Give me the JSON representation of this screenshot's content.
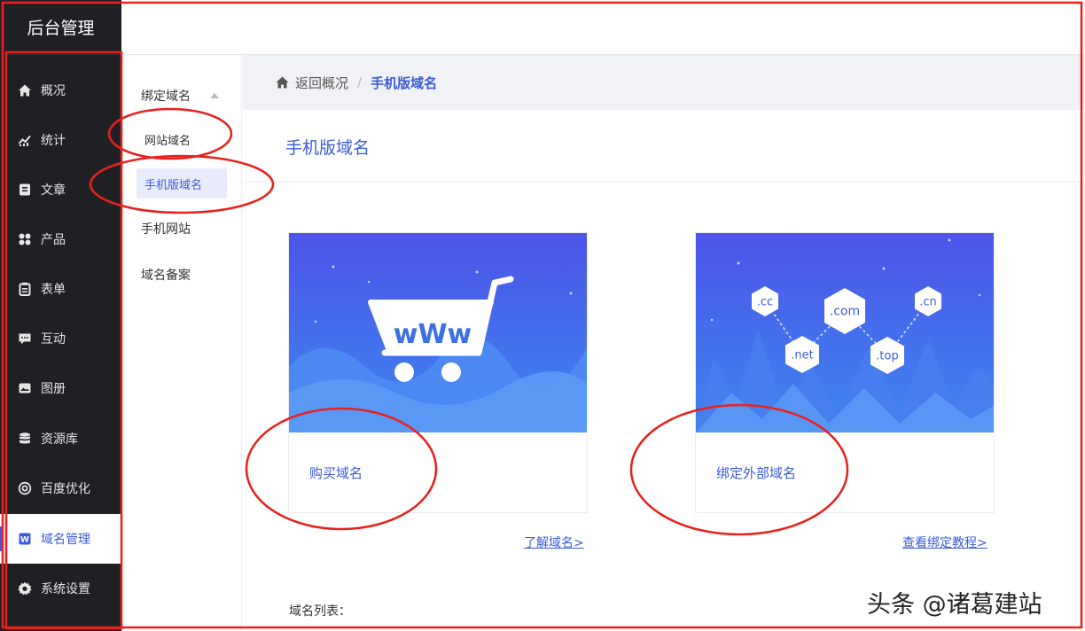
{
  "brand": "后台管理",
  "sidebar": {
    "items": [
      {
        "label": "概况",
        "icon": "home-icon"
      },
      {
        "label": "统计",
        "icon": "chart-icon"
      },
      {
        "label": "文章",
        "icon": "article-icon"
      },
      {
        "label": "产品",
        "icon": "grid-icon"
      },
      {
        "label": "表单",
        "icon": "clipboard-icon"
      },
      {
        "label": "互动",
        "icon": "chat-icon"
      },
      {
        "label": "图册",
        "icon": "album-icon"
      },
      {
        "label": "资源库",
        "icon": "database-icon"
      },
      {
        "label": "百度优化",
        "icon": "target-icon"
      },
      {
        "label": "域名管理",
        "icon": "domain-icon",
        "active": true
      },
      {
        "label": "系统设置",
        "icon": "gear-icon"
      }
    ]
  },
  "submenu": {
    "group": "绑定域名",
    "items": [
      "网站域名",
      "手机版域名"
    ],
    "extra": [
      "手机网站",
      "域名备案"
    ]
  },
  "breadcrumb": {
    "back": "返回概况",
    "separator": "/",
    "current": "手机版域名"
  },
  "page_title": "手机版域名",
  "cards": [
    {
      "caption": "购买域名",
      "link": "了解域名>",
      "illustration_text": "wWw"
    },
    {
      "caption": "绑定外部域名",
      "link": "查看绑定教程>",
      "tags": [
        ".cc",
        ".com",
        ".cn",
        ".net",
        ".top"
      ]
    }
  ],
  "list_label": "域名列表：",
  "watermark": "头条 @诸葛建站",
  "colors": {
    "accent": "#3b5bdb",
    "sidebar_bg": "#1f2024",
    "annotation": "#e8211d"
  }
}
